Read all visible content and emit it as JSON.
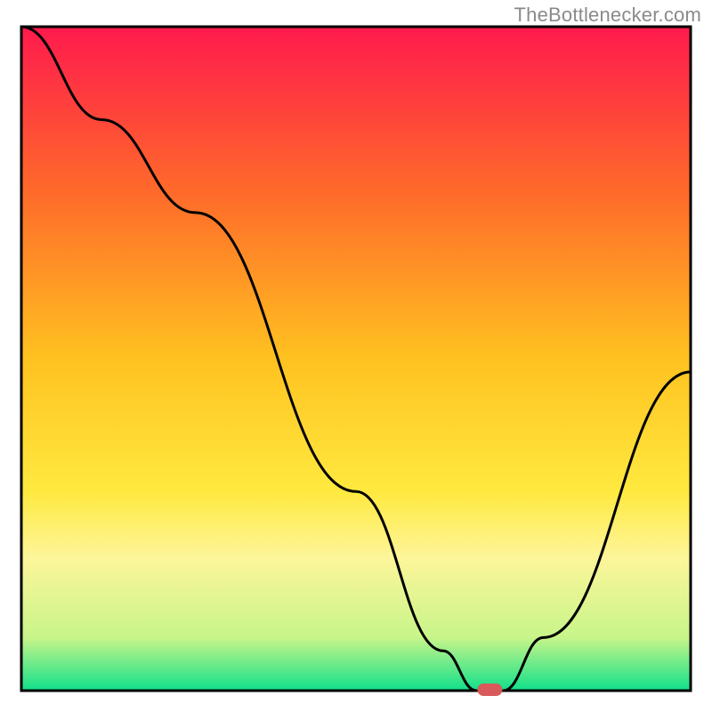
{
  "watermark": "TheBottlenecker.com",
  "chart_data": {
    "type": "line",
    "title": "",
    "xlabel": "",
    "ylabel": "",
    "xlim": [
      0,
      100
    ],
    "ylim": [
      0,
      100
    ],
    "background": {
      "kind": "vertical-gradient",
      "stops": [
        {
          "offset": 0,
          "color": "#ff1a4d"
        },
        {
          "offset": 25,
          "color": "#ff6a2a"
        },
        {
          "offset": 50,
          "color": "#ffc220"
        },
        {
          "offset": 70,
          "color": "#ffe93f"
        },
        {
          "offset": 80,
          "color": "#fdf59a"
        },
        {
          "offset": 92,
          "color": "#c8f58a"
        },
        {
          "offset": 100,
          "color": "#10e08a"
        }
      ]
    },
    "series": [
      {
        "name": "bottleneck-curve",
        "color": "#000000",
        "x": [
          0,
          12,
          26,
          50,
          63,
          68,
          72,
          78,
          100
        ],
        "values": [
          100,
          86,
          72,
          30,
          6,
          0,
          0,
          8,
          48
        ]
      }
    ],
    "marker": {
      "name": "optimal-point",
      "x": 70,
      "y": 0,
      "color": "#d85a5a",
      "shape": "rounded-rect"
    },
    "axes": {
      "color": "#000000",
      "show_ticks": false
    }
  }
}
